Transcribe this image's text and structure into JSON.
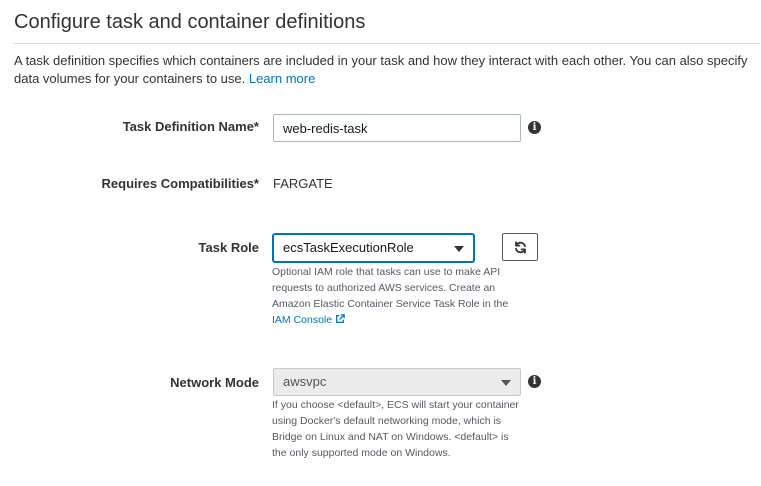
{
  "header": {
    "title": "Configure task and container definitions",
    "description": "A task definition specifies which containers are included in your task and how they interact with each other. You can also specify data volumes for your containers to use.",
    "learn_more": "Learn more"
  },
  "fields": {
    "task_definition_name": {
      "label": "Task Definition Name*",
      "value": "web-redis-task",
      "info_icon": "info-icon"
    },
    "requires_compatibilities": {
      "label": "Requires Compatibilities*",
      "value": "FARGATE"
    },
    "task_role": {
      "label": "Task Role",
      "selected": "ecsTaskExecutionRole",
      "refresh_icon": "refresh-icon",
      "help_text": "Optional IAM role that tasks can use to make API requests to authorized AWS services. Create an Amazon Elastic Container Service Task Role in the",
      "help_link": "IAM Console",
      "help_link_icon": "external-link-icon"
    },
    "network_mode": {
      "label": "Network Mode",
      "selected": "awsvpc",
      "info_icon": "info-icon",
      "help_text": "If you choose <default>, ECS will start your container using Docker's default networking mode, which is Bridge on Linux and NAT on Windows. <default> is the only supported mode on Windows."
    }
  },
  "colors": {
    "link": "#0073bb",
    "focus_border": "#0073bb",
    "text": "#333333",
    "help_text": "#545b64",
    "disabled_bg": "#ebebeb"
  }
}
